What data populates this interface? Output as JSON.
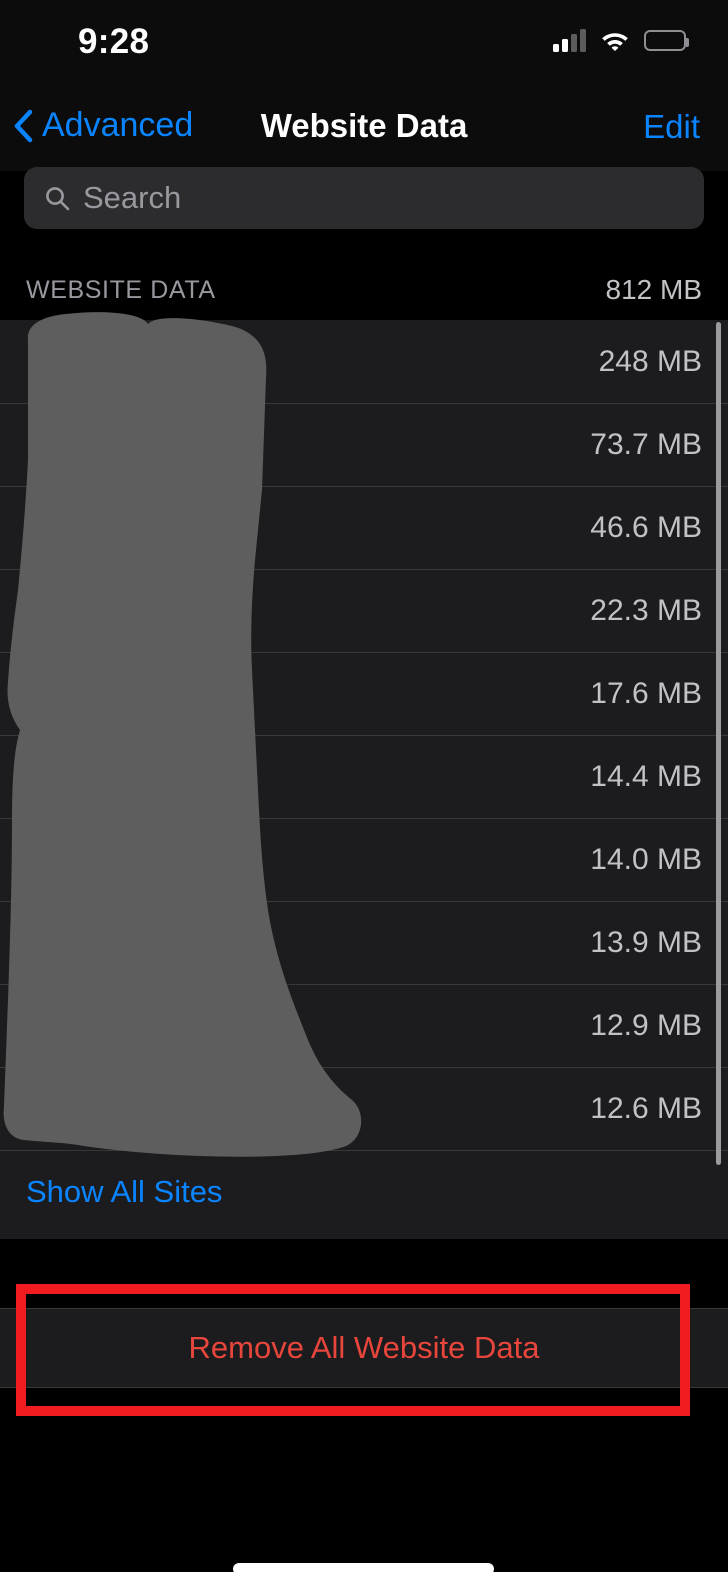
{
  "status_bar": {
    "time": "9:28",
    "cellular_icon": "cellular-signal-icon",
    "cellular_bars_filled": 2,
    "cellular_bars_total": 4,
    "wifi_icon": "wifi-icon",
    "battery_icon": "battery-icon",
    "battery_fill_percent": 65,
    "battery_color": "#ffd60a"
  },
  "nav_bar": {
    "back_icon": "chevron-left-icon",
    "back_label": "Advanced",
    "title": "Website Data",
    "edit_label": "Edit",
    "accent_color": "#0a84ff"
  },
  "search": {
    "icon": "search-icon",
    "placeholder": "Search",
    "value": ""
  },
  "section": {
    "header_label": "WEBSITE DATA",
    "total_size": "812 MB"
  },
  "sites": [
    {
      "name": "",
      "size": "248 MB"
    },
    {
      "name": "",
      "size": "73.7 MB"
    },
    {
      "name": "",
      "size": "46.6 MB"
    },
    {
      "name": "",
      "size": "22.3 MB"
    },
    {
      "name": "",
      "size": "17.6 MB"
    },
    {
      "name": "",
      "size": "14.4 MB"
    },
    {
      "name": "",
      "size": "14.0 MB"
    },
    {
      "name": "",
      "size": "13.9 MB"
    },
    {
      "name": "",
      "size": "12.9 MB"
    },
    {
      "name": "",
      "size": "12.6 MB"
    }
  ],
  "show_all": {
    "label": "Show All Sites"
  },
  "remove_all": {
    "label": "Remove All Website Data",
    "text_color": "#e8453c"
  },
  "annotation": {
    "type": "highlight-rectangle",
    "color": "#f01c20",
    "target": "remove-all-website-data-button"
  },
  "redaction": {
    "type": "scribble-mask",
    "color": "#5e5e5e",
    "covers": "website-name-labels"
  }
}
